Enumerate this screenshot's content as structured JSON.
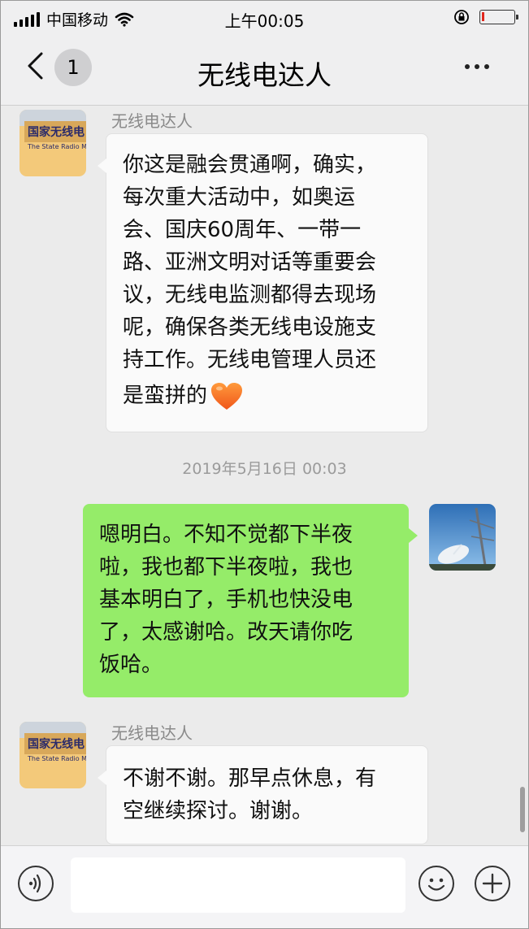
{
  "status_bar": {
    "carrier": "中国移动",
    "time": "上午00:05",
    "battery_level_percent": 8,
    "battery_color": "#e0271d",
    "icons": [
      "signal-icon",
      "wifi-icon",
      "rotation-lock-icon",
      "battery-icon"
    ]
  },
  "nav": {
    "back_icon": "chevron-left-icon",
    "unread_count": "1",
    "title": "无线电达人",
    "more_icon": "more-dots-icon"
  },
  "messages": [
    {
      "direction": "incoming",
      "sender": "无线电达人",
      "lines": [
        "你这是融会贯通啊，确实，",
        "每次重大活动中，如奥运",
        "会、国庆60周年、一带一",
        "路、亚洲文明对话等重要会",
        "议，无线电监测都得去现场",
        "呢，确保各类无线电设施支",
        "持工作。无线电管理人员还",
        "是蛮拼的"
      ],
      "emoji": "orange-heart-icon"
    },
    {
      "timestamp": "2019年5月16日 00:03"
    },
    {
      "direction": "outgoing",
      "lines": [
        "嗯明白。不知不觉都下半夜",
        "啦，我也都下半夜啦，我也",
        "基本明白了，手机也快没电",
        "了，太感谢哈。改天请你吃",
        "饭哈。"
      ]
    },
    {
      "direction": "incoming",
      "sender": "无线电达人",
      "lines": [
        "不谢不谢。那早点休息，有",
        "空继续探讨。谢谢。"
      ]
    }
  ],
  "input_bar": {
    "voice_icon": "voice-icon",
    "text_value": "",
    "emoji_icon": "emoji-icon",
    "plus_icon": "plus-icon"
  },
  "colors": {
    "outgoing_bubble": "#95ec69",
    "incoming_bubble": "#fafafa",
    "chat_background": "#ebebeb"
  }
}
